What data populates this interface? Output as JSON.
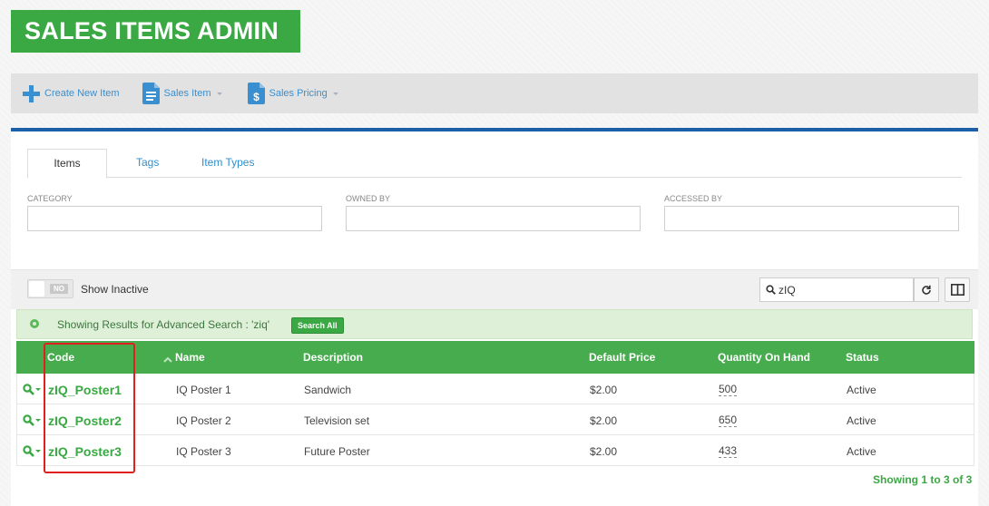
{
  "app": {
    "title": "SALES ITEMS ADMIN"
  },
  "toolbar": {
    "create_label": "Create New Item",
    "sales_item_label": "Sales Item",
    "sales_pricing_label": "Sales Pricing"
  },
  "tabs": [
    {
      "label": "Items",
      "active": true
    },
    {
      "label": "Tags",
      "active": false
    },
    {
      "label": "Item Types",
      "active": false
    }
  ],
  "filters": {
    "category_label": "CATEGORY",
    "owned_by_label": "OWNED BY",
    "accessed_by_label": "ACCESSED BY",
    "category_value": "",
    "owned_by_value": "",
    "accessed_by_value": ""
  },
  "list_controls": {
    "toggle_label": "NO",
    "show_inactive_label": "Show Inactive",
    "search_value": "zIQ"
  },
  "advanced_search": {
    "message": "Showing Results for Advanced Search : 'ziq'",
    "button_label": "Search All"
  },
  "grid": {
    "columns": [
      "Code",
      "Name",
      "Description",
      "Default Price",
      "Quantity On Hand",
      "Status"
    ],
    "sorted_column": "Name",
    "rows": [
      {
        "code": "zIQ_Poster1",
        "name": "IQ Poster 1",
        "description": "Sandwich",
        "price": "$2.00",
        "qty": "500",
        "status": "Active"
      },
      {
        "code": "zIQ_Poster2",
        "name": "IQ Poster 2",
        "description": "Television set",
        "price": "$2.00",
        "qty": "650",
        "status": "Active"
      },
      {
        "code": "zIQ_Poster3",
        "name": "IQ Poster 3",
        "description": "Future Poster",
        "price": "$2.00",
        "qty": "433",
        "status": "Active"
      }
    ]
  },
  "footer": {
    "showing": "Showing 1 to 3 of 3"
  },
  "colors": {
    "brand_green": "#3aa843",
    "link_blue": "#3a8fd0",
    "rule_blue": "#1b5fa8",
    "highlight_red": "#e0201f"
  }
}
